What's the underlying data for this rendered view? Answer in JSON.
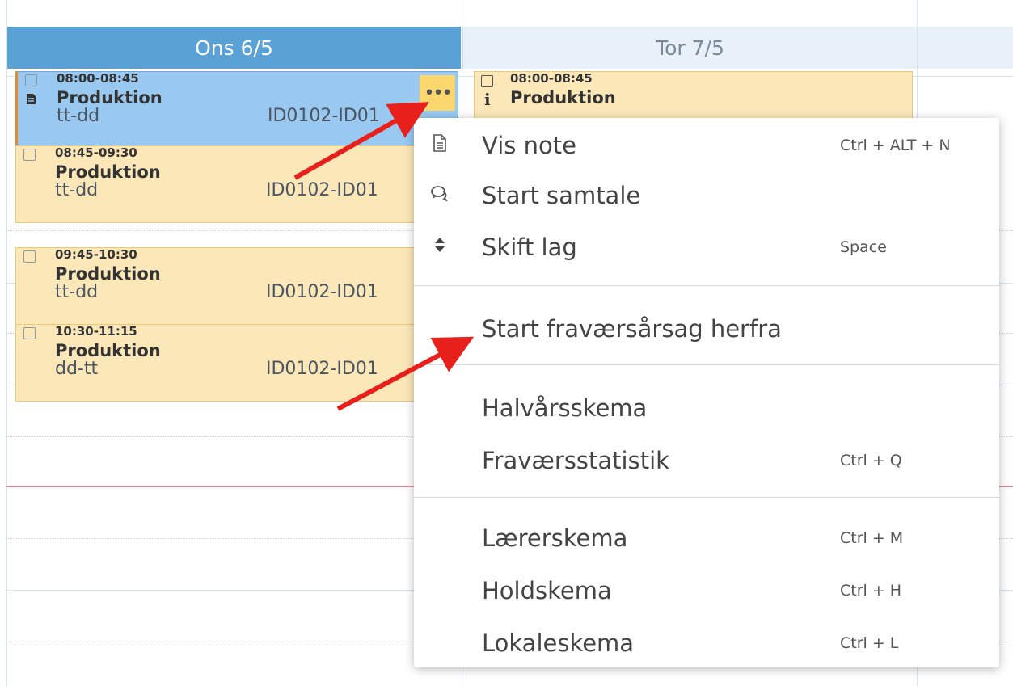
{
  "days": {
    "active": "Ons 6/5",
    "next": "Tor 7/5"
  },
  "events": [
    {
      "time": "08:00-08:45",
      "title": "Produktion",
      "group": "tt-dd",
      "id": "ID0102-ID01"
    },
    {
      "time": "08:45-09:30",
      "title": "Produktion",
      "group": "tt-dd",
      "id": "ID0102-ID01"
    },
    {
      "time": "09:45-10:30",
      "title": "Produktion",
      "group": "tt-dd",
      "id": "ID0102-ID01"
    },
    {
      "time": "10:30-11:15",
      "title": "Produktion",
      "group": "dd-tt",
      "id": "ID0102-ID01"
    }
  ],
  "next_event": {
    "time": "08:00-08:45",
    "title": "Produktion",
    "info_icon": "i"
  },
  "more_button": "•••",
  "menu": {
    "items": [
      {
        "label": "Vis note",
        "shortcut": "Ctrl + ALT + N",
        "icon": "note-icon"
      },
      {
        "label": "Start samtale",
        "shortcut": "",
        "icon": "chat-icon"
      },
      {
        "label": "Skift lag",
        "shortcut": "Space",
        "icon": "sort-icon"
      },
      {
        "label": "Start fraværsårsag herfra",
        "shortcut": ""
      },
      {
        "label": "Halvårsskema",
        "shortcut": ""
      },
      {
        "label": "Fraværsstatistik",
        "shortcut": "Ctrl + Q"
      },
      {
        "label": "Lærerskema",
        "shortcut": "Ctrl + M"
      },
      {
        "label": "Holdskema",
        "shortcut": "Ctrl + H"
      },
      {
        "label": "Lokaleskema",
        "shortcut": "Ctrl + L"
      }
    ]
  },
  "colors": {
    "active_header": "#5aa2d6",
    "event_bg": "#fbe7b8",
    "selected_event_bg": "#99c9f1",
    "arrow": "#e8201c"
  }
}
